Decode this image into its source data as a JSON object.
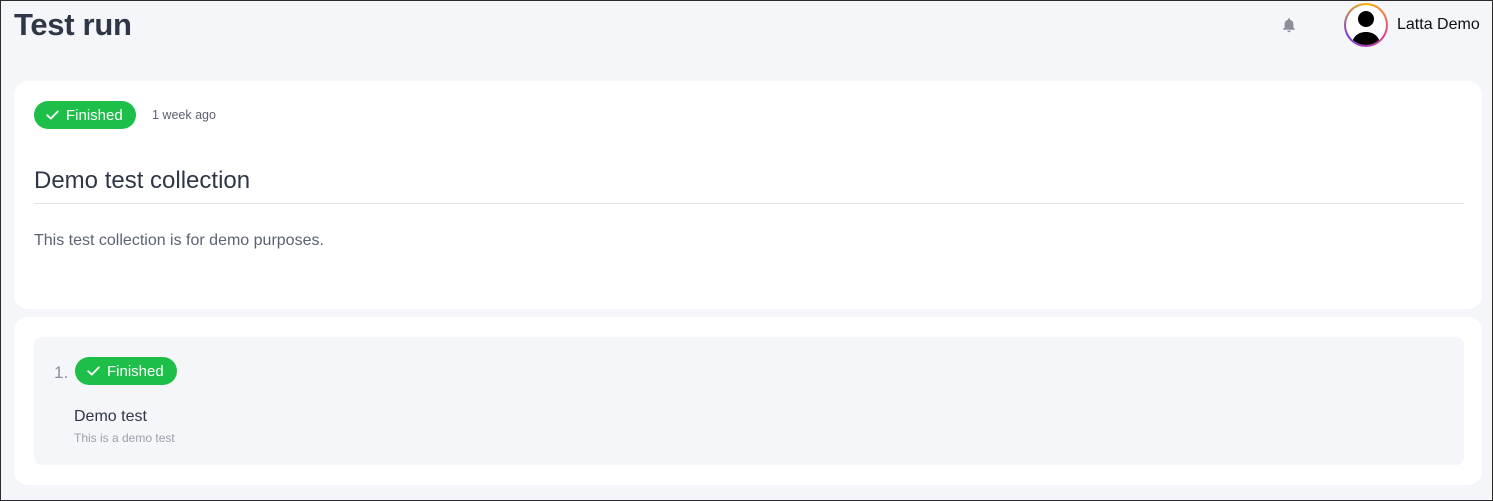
{
  "page": {
    "title": "Test run"
  },
  "header": {
    "notifications_icon": "bell-icon",
    "user": {
      "name": "Latta Demo",
      "avatar_icon": "user-silhouette-icon"
    }
  },
  "run": {
    "status": "Finished",
    "status_icon": "check-icon",
    "status_color": "#1dbf48",
    "time_ago": "1 week ago",
    "title": "Demo test collection",
    "description": "This test collection is for demo purposes."
  },
  "tests": [
    {
      "index": "1.",
      "status": "Finished",
      "status_icon": "check-icon",
      "name": "Demo test",
      "description": "This is a demo test"
    }
  ]
}
